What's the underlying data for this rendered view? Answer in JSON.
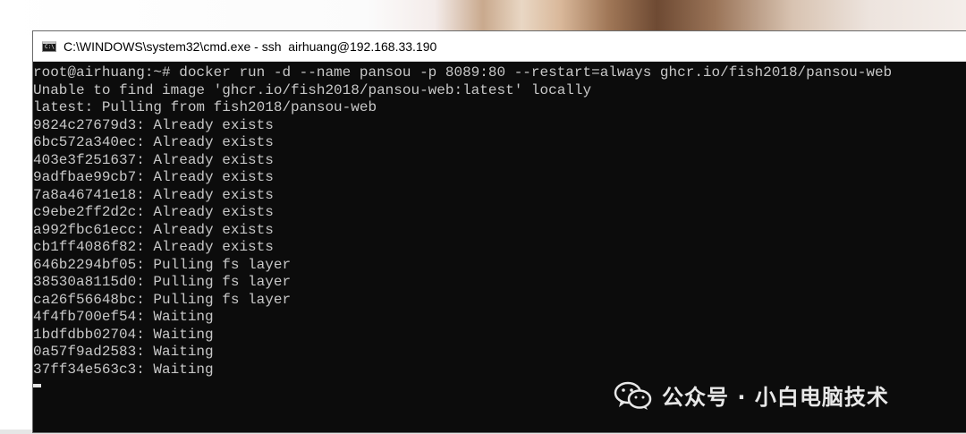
{
  "window": {
    "title": "C:\\WINDOWS\\system32\\cmd.exe - ssh  airhuang@192.168.33.190",
    "icon": "cmd-icon"
  },
  "terminal": {
    "lines": [
      "root@airhuang:~# docker run -d --name pansou -p 8089:80 --restart=always ghcr.io/fish2018/pansou-web",
      "Unable to find image 'ghcr.io/fish2018/pansou-web:latest' locally",
      "latest: Pulling from fish2018/pansou-web",
      "9824c27679d3: Already exists",
      "6bc572a340ec: Already exists",
      "403e3f251637: Already exists",
      "9adfbae99cb7: Already exists",
      "7a8a46741e18: Already exists",
      "c9ebe2ff2d2c: Already exists",
      "a992fbc61ecc: Already exists",
      "cb1ff4086f82: Already exists",
      "646b2294bf05: Pulling fs layer",
      "38530a8115d0: Pulling fs layer",
      "ca26f56648bc: Pulling fs layer",
      "4f4fb700ef54: Waiting",
      "1bdfdbb02704: Waiting",
      "0a57f9ad2583: Waiting",
      "37ff34e563c3: Waiting"
    ]
  },
  "watermark": {
    "text": "公众号 · 小白电脑技术",
    "icon": "wechat-icon"
  }
}
